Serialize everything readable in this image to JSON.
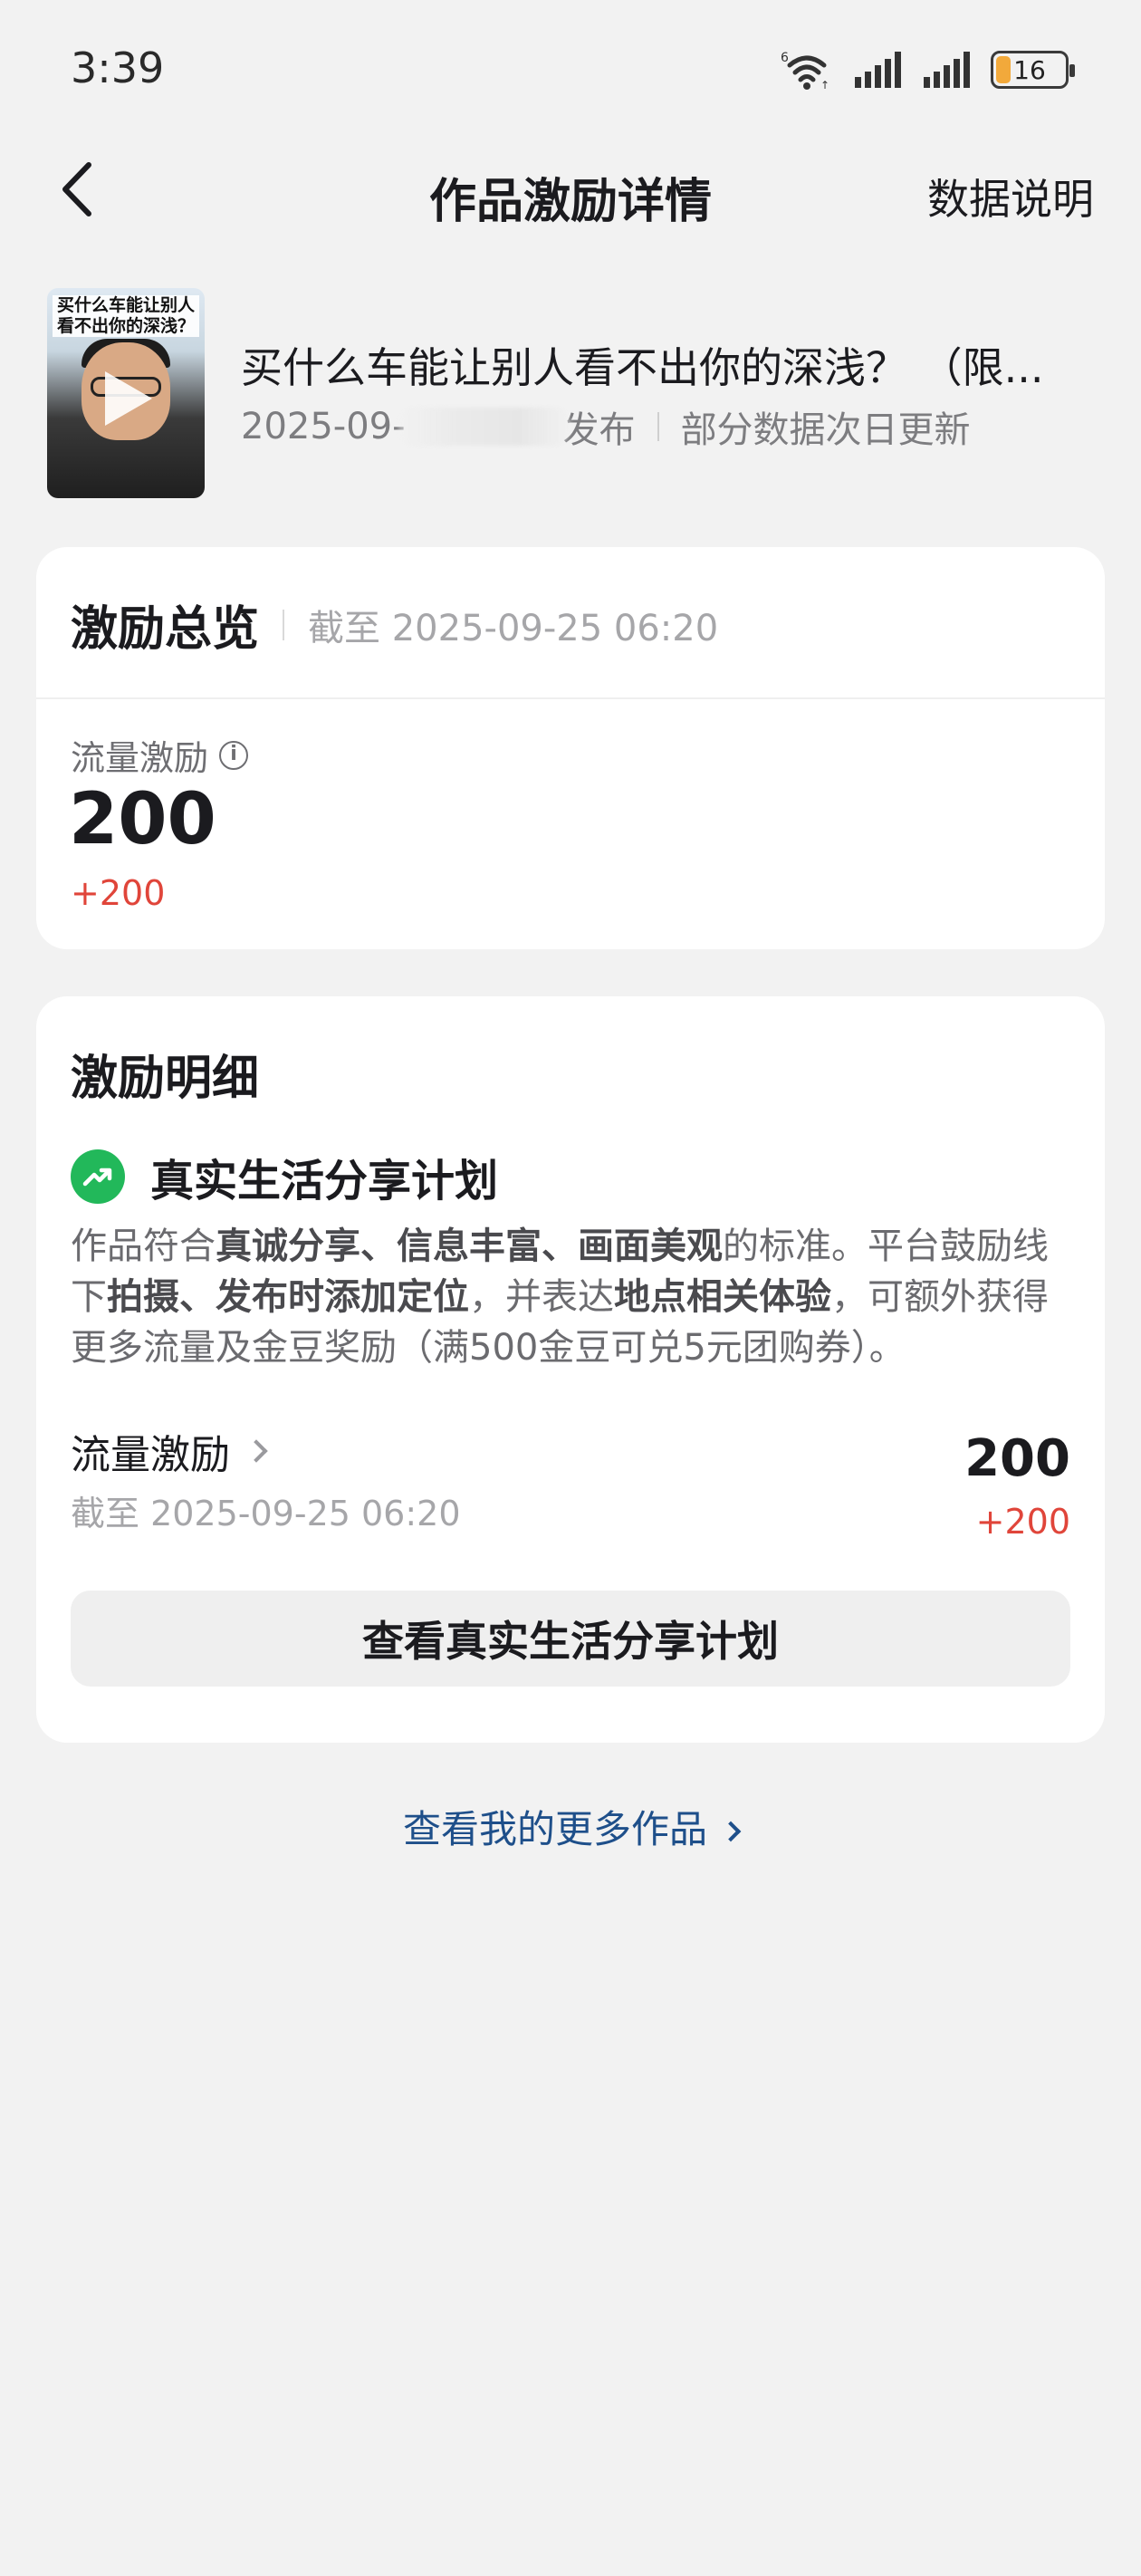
{
  "status_bar": {
    "time": "3:39",
    "battery": "16",
    "icons": [
      "wifi-6-icon",
      "signal-icon",
      "signal-icon",
      "battery-icon"
    ]
  },
  "nav": {
    "back_icon": "chevron-left-icon",
    "title": "作品激励详情",
    "action": "数据说明"
  },
  "work": {
    "thumbnail_caption_line1": "买什么车能让别人",
    "thumbnail_caption_line2": "看不出你的深浅？",
    "title": "买什么车能让别人看不出你的深浅？ （限...",
    "date_prefix": "2025-09-",
    "date_suffix": "发布",
    "update_note": "部分数据次日更新"
  },
  "overview": {
    "title": "激励总览",
    "as_of": "截至 2025-09-25 06:20",
    "metric_label": "流量激励",
    "metric_value": "200",
    "metric_delta": "+200"
  },
  "detail": {
    "title": "激励明细",
    "plan_name": "真实生活分享计划",
    "plan_icon": "trending-up-icon",
    "desc": {
      "p1": "作品符合",
      "b1": "真诚分享、信息丰富、画面美观",
      "p2": "的标准。平台鼓励线下",
      "b2": "拍摄、发布时添加定位",
      "p3": "，并表达",
      "b3": "地点相关体验",
      "p4": "，可额外获得更多流量及金豆奖励（满500金豆可兑5元团购券）。"
    },
    "flow_label": "流量激励",
    "flow_date": "截至 2025-09-25 06:20",
    "flow_value": "200",
    "flow_delta": "+200",
    "button_label": "查看真实生活分享计划"
  },
  "more_works": "查看我的更多作品",
  "colors": {
    "background": "#f2f2f2",
    "card": "#ffffff",
    "delta_red": "#e0453a",
    "plan_green": "#22b85a",
    "link_blue": "#1e4f8a"
  }
}
